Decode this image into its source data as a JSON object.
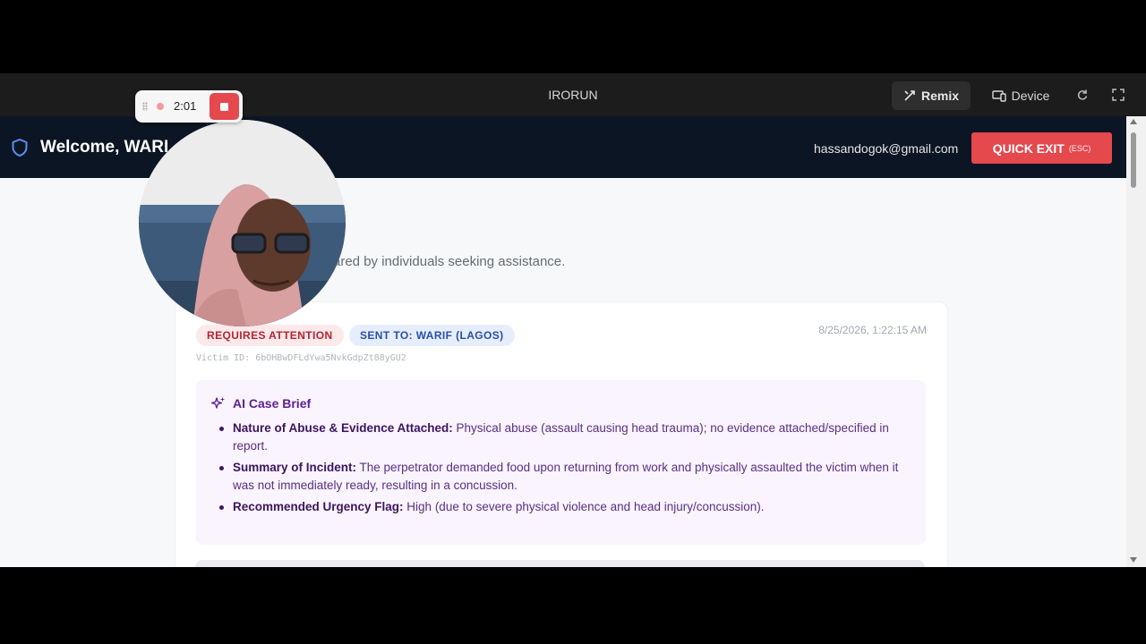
{
  "frame": {
    "title": "IRORUN",
    "remix_label": "Remix",
    "device_label": "Device"
  },
  "recorder": {
    "time": "2:01"
  },
  "header": {
    "welcome": "Welcome, WARI",
    "email": "hassandogok@gmail.com",
    "quick_exit_label": "QUICK EXIT",
    "quick_exit_shortcut": "(ESC)"
  },
  "page": {
    "subtitle": "ared by individuals seeking assistance."
  },
  "report": {
    "status_badge": "REQUIRES ATTENTION",
    "sent_to_badge": "SENT TO: WARIF (LAGOS)",
    "timestamp": "8/25/2026, 1:22:15 AM",
    "victim_id": "Victim ID: 6bOHBwDFLdYwa5NvkGdpZt88yGU2",
    "brief_title": "AI Case Brief",
    "brief_items": [
      {
        "label": "Nature of Abuse & Evidence Attached:",
        "text": " Physical abuse (assault causing head trauma); no evidence attached/specified in report."
      },
      {
        "label": "Summary of Incident:",
        "text": " The perpetrator demanded food upon returning from work and physically assaulted the victim when it was not immediately ready, resulting in a concussion."
      },
      {
        "label": "Recommended Urgency Flag:",
        "text": " High (due to severe physical violence and head injury/concussion)."
      }
    ]
  },
  "colors": {
    "header_bg": "#0c1523",
    "danger": "#e5484d",
    "brief_bg": "#f9f4fd",
    "brief_accent": "#5b1f93"
  },
  "icons": {
    "header": "shield-icon",
    "brief": "sparkles-icon",
    "remix": "remix-icon",
    "device": "device-icon"
  }
}
